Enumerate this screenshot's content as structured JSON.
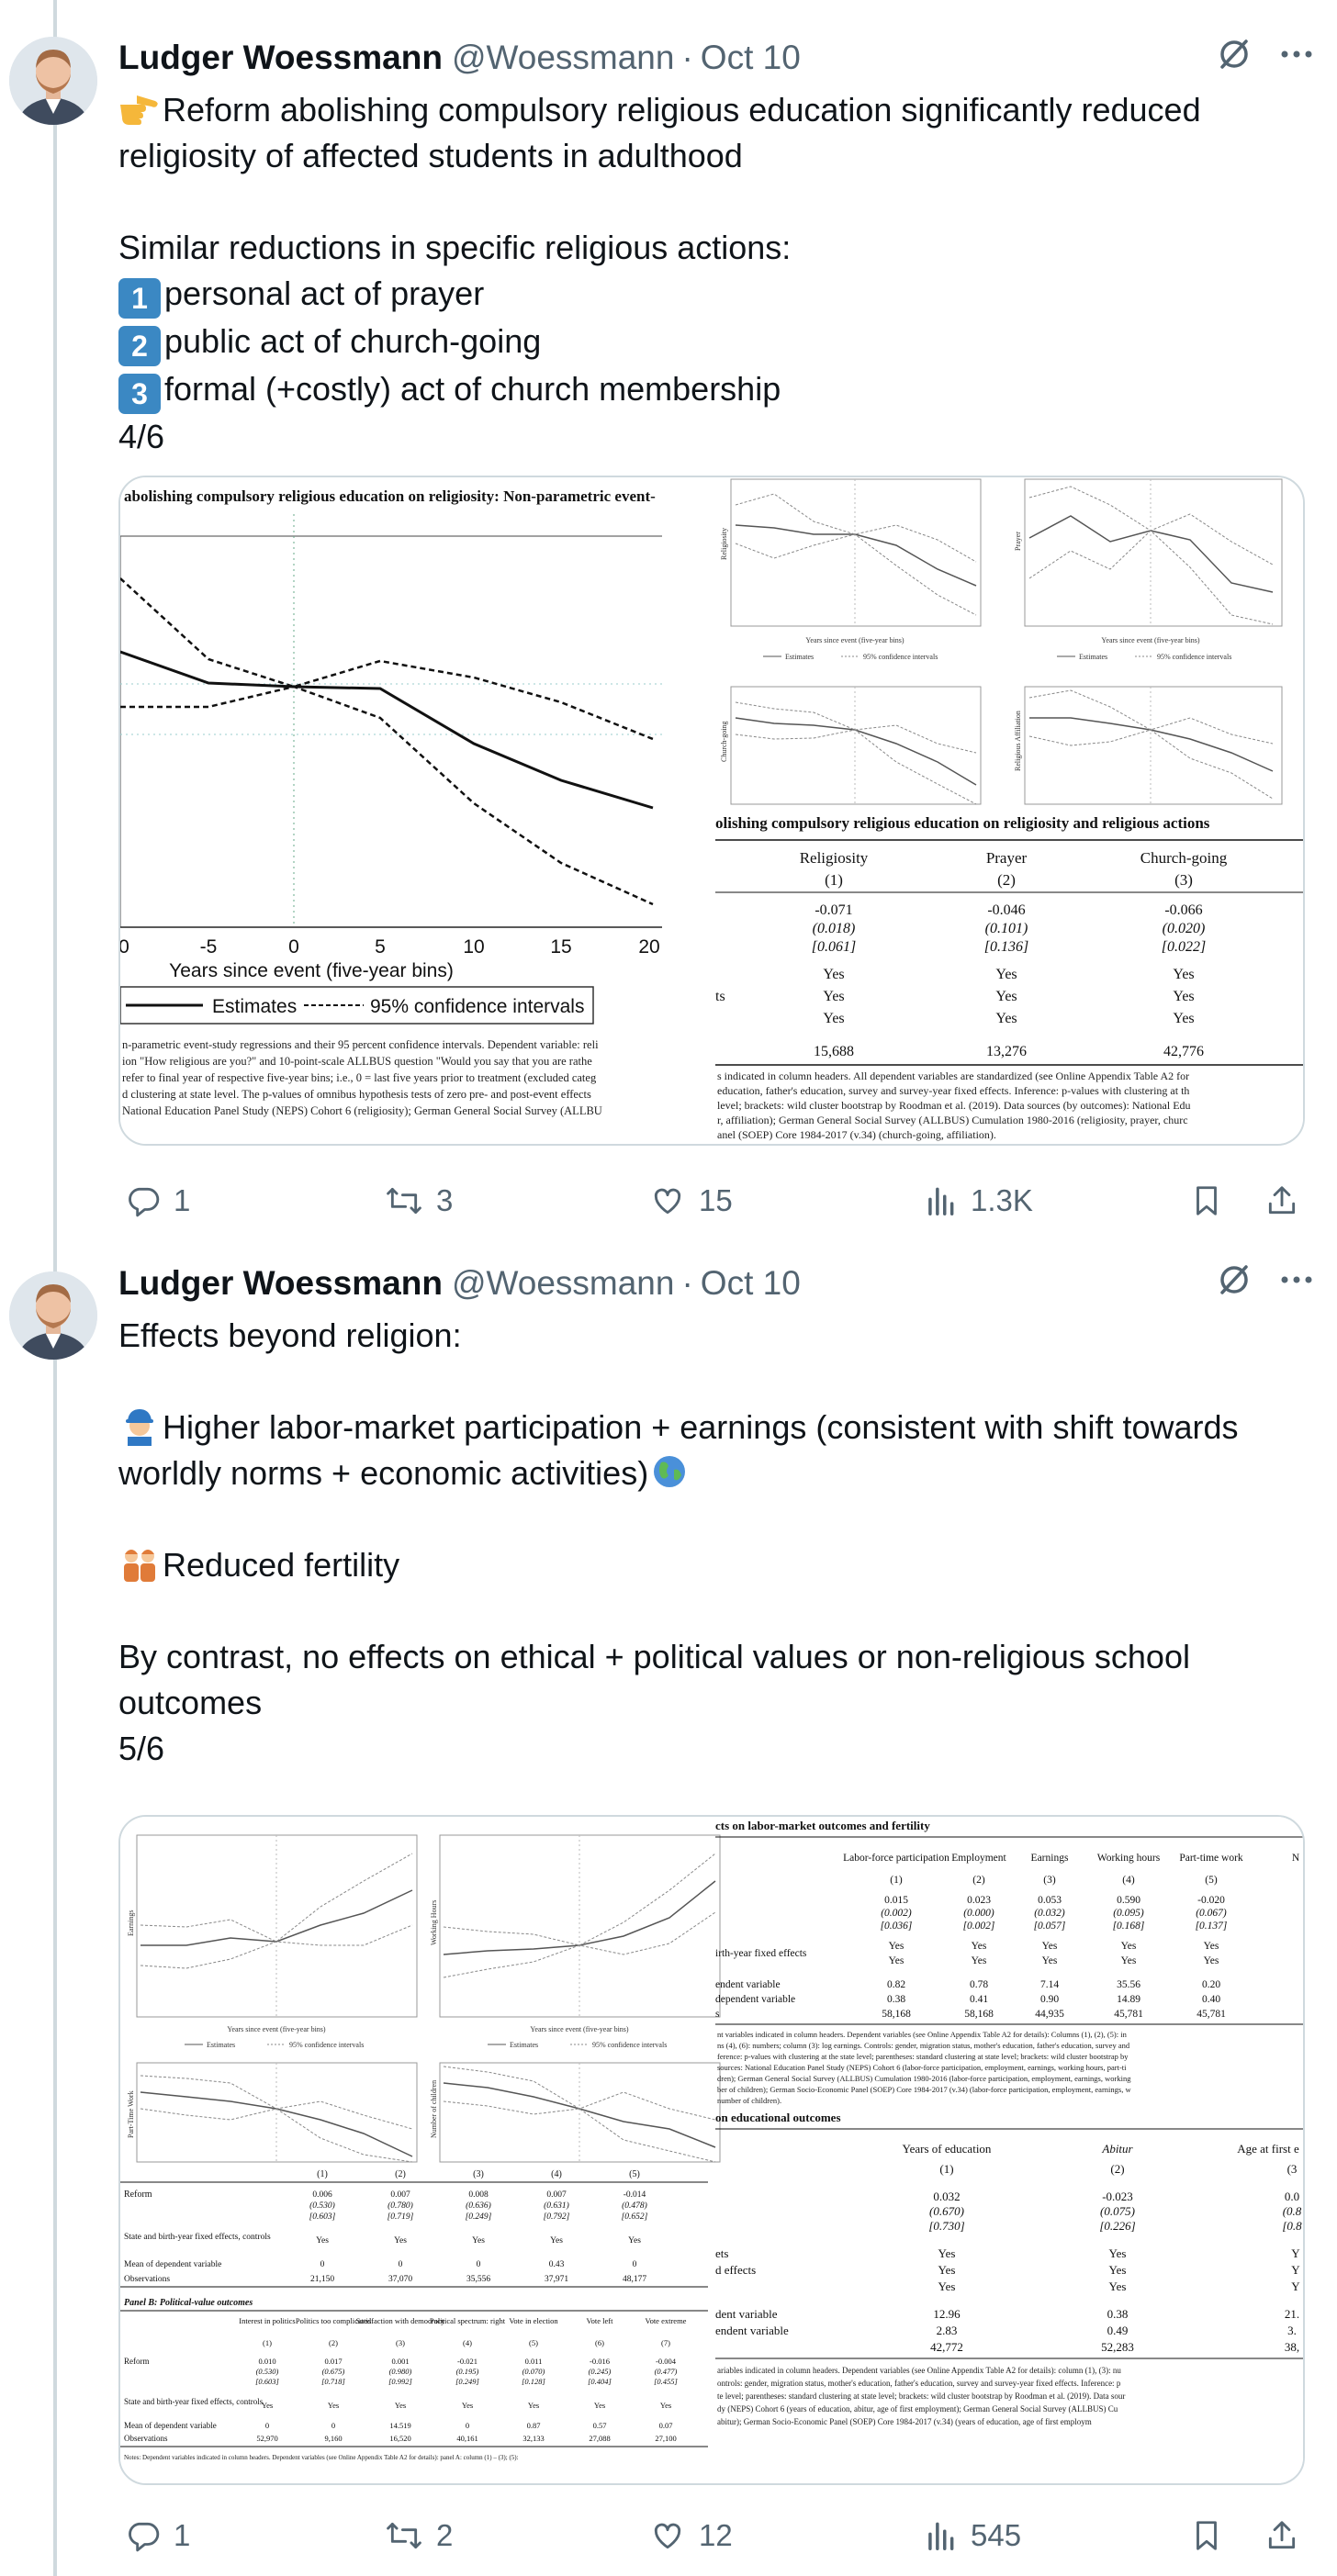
{
  "tweets": [
    {
      "author_name": "Ludger Woessmann",
      "author_handle": "@Woessmann",
      "separator": "·",
      "date": "Oct 10",
      "text_line1": "Reform abolishing compulsory religious education significantly reduced religiosity of affected students in adulthood",
      "text_line2": "Similar reductions in specific religious actions:",
      "list": [
        {
          "num": "1",
          "text": "personal act of prayer"
        },
        {
          "num": "2",
          "text": "public act of church-going"
        },
        {
          "num": "3",
          "text": "formal (+costly) act of church membership"
        }
      ],
      "counter": "4/6",
      "media": {
        "main_title": "abolishing compulsory religious education on religiosity: Non-parametric event-",
        "main_xticks": [
          "0",
          "-5",
          "0",
          "5",
          "10",
          "15",
          "20"
        ],
        "main_xlabel": "Years since event (five-year bins)",
        "legend_estimates": "Estimates",
        "legend_ci": "95% confidence intervals",
        "notes": [
          "n-parametric event-study regressions and their 95 percent confidence intervals. Dependent variable: reli",
          "ion \"How religious are you?\" and 10-point-scale ALLBUS question \"Would you say that you are rathe",
          "refer to final year of respective five-year bins; i.e., 0 = last five years prior to treatment (excluded categ",
          "d clustering at state level. The p-values of omnibus hypothesis tests of zero pre- and post-event effects",
          "National Education Panel Study (NEPS) Cohort 6 (religiosity); German General Social Survey (ALLBU"
        ],
        "small_ylabels": [
          "Religiosity",
          "Prayer",
          "Church-going",
          "Religious Affiliation"
        ],
        "small_xlabel": "Years since event (five-year bins)",
        "table_title": "olishing compulsory religious education on religiosity and religious actions",
        "columns": [
          {
            "name": "Religiosity",
            "num": "(1)",
            "coef": "-0.071",
            "se": "(0.018)",
            "p": "[0.061]",
            "obs": "15,688"
          },
          {
            "name": "Prayer",
            "num": "(2)",
            "coef": "-0.046",
            "se": "(0.101)",
            "p": "[0.136]",
            "obs": "13,276"
          },
          {
            "name": "Church-going",
            "num": "(3)",
            "coef": "-0.066",
            "se": "(0.020)",
            "p": "[0.022]",
            "obs": "42,776"
          }
        ],
        "row_ts": "ts",
        "yes": "Yes",
        "table_notes": [
          "s indicated in column headers. All dependent variables are standardized (see Online Appendix Table A2 for",
          "education, father's education, survey and survey-year fixed effects. Inference: p-values with clustering at th",
          "level; brackets: wild cluster bootstrap by Roodman et al. (2019). Data sources (by outcomes): National Edu",
          "r, affiliation); German General Social Survey (ALLBUS) Cumulation 1980-2016 (religiosity, prayer, churc",
          "anel (SOEP) Core 1984-2017 (v.34) (church-going, affiliation)."
        ]
      },
      "stats": {
        "replies": "1",
        "reposts": "3",
        "likes": "15",
        "views": "1.3K"
      }
    },
    {
      "author_name": "Ludger Woessmann",
      "author_handle": "@Woessmann",
      "separator": "·",
      "date": "Oct 10",
      "text_line1": "Effects beyond religion:",
      "text_line2": "Higher labor-market participation + earnings (consistent with shift towards worldly norms + economic activities)",
      "text_line3": "Reduced fertility",
      "text_line4": "By contrast, no effects on ethical + political values or non-religious school outcomes",
      "counter": "5/6",
      "media": {
        "small_ylabels": [
          "Earnings",
          "Working Hours",
          "Part-Time Work",
          "Number of children"
        ],
        "small_xlabel": "Years since event (five-year bins)",
        "legend_estimates": "Estimates",
        "legend_ci": "95% confidence intervals",
        "left_table": {
          "nums": [
            "(1)",
            "(2)",
            "(3)",
            "(4)",
            "(5)"
          ],
          "reform_label": "Reform",
          "coefs": [
            "0.006",
            "0.007",
            "0.008",
            "0.007",
            "-0.014"
          ],
          "ses": [
            "(0.530)",
            "(0.780)",
            "(0.636)",
            "(0.631)",
            "(0.478)"
          ],
          "ps": [
            "[0.603]",
            "[0.719]",
            "[0.249]",
            "[0.792]",
            "[0.652]"
          ],
          "controls_label": "State and birth-year fixed effects, controls",
          "yes": "Yes",
          "mean_label": "Mean of dependent variable",
          "means": [
            "0",
            "0",
            "0",
            "0.43",
            "0"
          ],
          "obs_label": "Observations",
          "obs": [
            "21,150",
            "37,070",
            "35,556",
            "37,971",
            "48,177"
          ],
          "panel_b": "Panel B: Political-value outcomes",
          "b_headers": [
            "Interest in politics",
            "Politics too complicated",
            "Satisfaction with democracy",
            "Political spectrum: right",
            "Vote in election",
            "Vote left",
            "Vote extreme"
          ],
          "b_nums": [
            "(1)",
            "(2)",
            "(3)",
            "(4)",
            "(5)",
            "(6)",
            "(7)"
          ],
          "b_coefs": [
            "0.010",
            "0.017",
            "0.001",
            "-0.021",
            "0.011",
            "-0.016",
            "-0.004"
          ],
          "b_ses": [
            "(0.530)",
            "(0.675)",
            "(0.980)",
            "(0.195)",
            "(0.070)",
            "(0.245)",
            "(0.477)"
          ],
          "b_ps": [
            "[0.603]",
            "[0.718]",
            "[0.992]",
            "[0.249]",
            "[0.128]",
            "[0.404]",
            "[0.455]"
          ],
          "b_means": [
            "0",
            "0",
            "14.519",
            "0",
            "0.87",
            "0.57",
            "0.07"
          ],
          "b_obs": [
            "52,970",
            "9,160",
            "16,520",
            "40,161",
            "32,133",
            "27,088",
            "27,100"
          ],
          "b_notes": "Notes: Dependent variables indicated in column headers. Dependent variables (see Online Appendix Table A2 for details): panel A: column (1) – (3); (5):"
        },
        "right_table": {
          "title": "cts on labor-market outcomes and fertility",
          "headers": [
            "Labor-force participation",
            "Employment",
            "Earnings",
            "Working hours",
            "Part-time work",
            "N"
          ],
          "nums": [
            "(1)",
            "(2)",
            "(3)",
            "(4)",
            "(5)"
          ],
          "coefs": [
            "0.015",
            "0.023",
            "0.053",
            "0.590",
            "-0.020"
          ],
          "ses": [
            "(0.002)",
            "(0.000)",
            "(0.032)",
            "(0.095)",
            "(0.067)"
          ],
          "ps": [
            "[0.036]",
            "[0.002]",
            "[0.057]",
            "[0.168]",
            "[0.137]"
          ],
          "row1_label": "irth-year fixed effects",
          "yes": "Yes",
          "mean_label": "endent variable",
          "means": [
            "0.82",
            "0.78",
            "7.14",
            "35.56",
            "0.20"
          ],
          "sd_label": "dependent variable",
          "sds": [
            "0.38",
            "0.41",
            "0.90",
            "14.89",
            "0.40"
          ],
          "obs_label": "s",
          "obs": [
            "58,168",
            "58,168",
            "44,935",
            "45,781",
            "45,781"
          ],
          "notes": [
            "nt variables indicated in column headers. Dependent variables (see Online Appendix Table A2 for details): Columns (1), (2), (5): in",
            "ns (4), (6): numbers; column (3): log earnings. Controls: gender, migration status, mother's education, father's education, survey and",
            "ference: p-values with clustering at the state level; parentheses: standard clustering at state level; brackets: wild cluster bootstrap by",
            "sources: National Education Panel Study (NEPS) Cohort 6 (labor-force participation, employment, earnings, working hours, part-ti",
            "dren); German General Social Survey (ALLBUS) Cumulation 1980-2016 (labor-force participation, employment, earnings, working",
            "ber of children); German Socio-Economic Panel (SOEP) Core 1984-2017 (v.34) (labor-force participation, employment, earnings, w",
            "number of children)."
          ],
          "edu_title": "on educational outcomes",
          "edu_headers": [
            "Years of education",
            "Abitur",
            "Age at first e"
          ],
          "edu_nums": [
            "(1)",
            "(2)",
            "(3"
          ],
          "edu_coefs": [
            "0.032",
            "-0.023",
            "0.0"
          ],
          "edu_ses": [
            "(0.670)",
            "(0.075)",
            "(0.8"
          ],
          "edu_ps": [
            "[0.730]",
            "[0.226]",
            "[0.8"
          ],
          "edu_row1": "ets",
          "edu_row2": "d effects",
          "edu_yes_last": "Y",
          "edu_mean_label": "dent variable",
          "edu_means": [
            "12.96",
            "0.38",
            "21."
          ],
          "edu_sd_label": "endent variable",
          "edu_sds": [
            "2.83",
            "0.49",
            "3."
          ],
          "edu_obs": [
            "42,772",
            "52,283",
            "38,"
          ],
          "edu_notes": [
            "ariables indicated in column headers. Dependent variables (see Online Appendix Table A2 for details): column (1), (3): nu",
            "ontrols: gender, migration status, mother's education, father's education, survey and survey-year fixed effects. Inference: p",
            "te level; parentheses: standard clustering at state level; brackets: wild cluster bootstrap by Roodman et al. (2019). Data sour",
            "dy (NEPS) Cohort 6 (years of education, abitur, age of first employment); German General Social Survey (ALLBUS) Cu",
            "abitur); German Socio-Economic Panel (SOEP) Core 1984-2017 (v.34) (years of education, age of first employm"
          ]
        }
      },
      "stats": {
        "replies": "1",
        "reposts": "2",
        "likes": "12",
        "views": "545"
      }
    }
  ],
  "icons": {
    "avatar": "author-avatar",
    "grok": "grok-icon",
    "more": "more-icon",
    "reply": "reply-icon",
    "repost": "repost-icon",
    "like": "heart-icon",
    "views": "views-icon",
    "bookmark": "bookmark-icon",
    "share": "share-icon"
  },
  "colors": {
    "text": "#0f1419",
    "muted": "#536471",
    "thread": "#cfd9de",
    "keycap": "#3b88c3"
  }
}
